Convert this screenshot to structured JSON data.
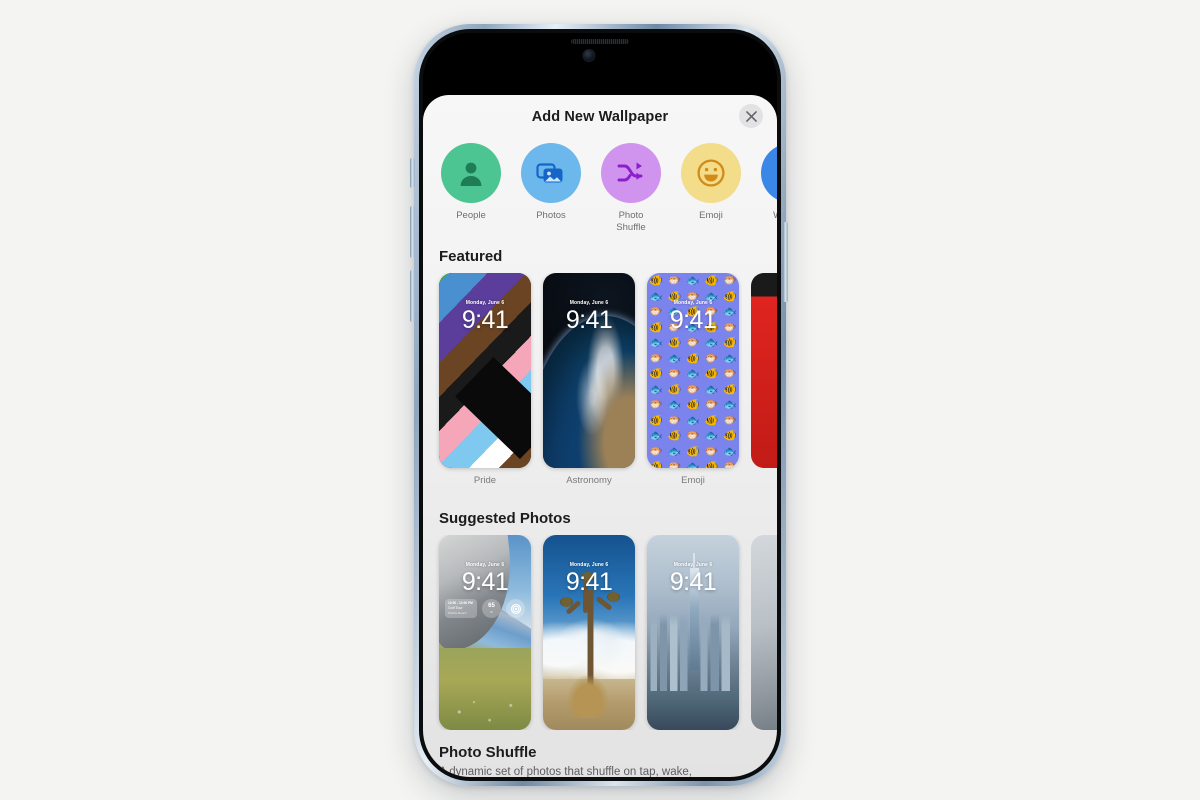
{
  "sheet": {
    "title": "Add New Wallpaper",
    "close_icon": "close-x-icon"
  },
  "categories": [
    {
      "id": "people",
      "label": "People",
      "icon": "person-icon",
      "color": "#4cc592"
    },
    {
      "id": "photos",
      "label": "Photos",
      "icon": "photo-stack-icon",
      "color": "#6cb8ec"
    },
    {
      "id": "photo-shuffle",
      "label": "Photo\nShuffle",
      "icon": "shuffle-icon",
      "color": "#d094ee"
    },
    {
      "id": "emoji",
      "label": "Emoji",
      "icon": "smiley-icon",
      "color": "#f3dc8a"
    },
    {
      "id": "weather",
      "label": "Weather",
      "icon": "sun-cloud-icon",
      "color": "#3b87e8"
    }
  ],
  "category_icon_colors": {
    "people": "#1f7d55",
    "photos": "#1565c9",
    "photo_shuffle": "#8b1fce",
    "emoji": "#d18b18",
    "weather": "#1d2ab0"
  },
  "featured": {
    "title": "Featured",
    "items": [
      {
        "name": "Pride",
        "date": "Monday, June 6",
        "time": "9:41"
      },
      {
        "name": "Astronomy",
        "date": "Monday, June 6",
        "time": "9:41"
      },
      {
        "name": "Emoji",
        "date": "Monday, June 6",
        "time": "9:41"
      }
    ],
    "emoji_glyphs": [
      "🐠",
      "🐡",
      "🐟",
      "🐠",
      "🐡",
      "🐟",
      "🐠",
      "🐡",
      "🐟",
      "🐠",
      "🐡",
      "🐟",
      "🐠",
      "🐡",
      "🐟",
      "🐠",
      "🐡",
      "🐟",
      "🐠",
      "🐡",
      "🐟",
      "🐠",
      "🐡",
      "🐟",
      "🐠",
      "🐡",
      "🐟",
      "🐠",
      "🐡",
      "🐟",
      "🐠",
      "🐡",
      "🐟",
      "🐠",
      "🐡",
      "🐟",
      "🐠",
      "🐡",
      "🐟",
      "🐠",
      "🐡",
      "🐟",
      "🐠",
      "🐡",
      "🐟",
      "🐠",
      "🐡",
      "🐟",
      "🐠",
      "🐡",
      "🐟",
      "🐠",
      "🐡",
      "🐟",
      "🐠",
      "🐡",
      "🐟",
      "🐠",
      "🐡",
      "🐟",
      "🐠",
      "🐡",
      "🐟",
      "🐠",
      "🐡"
    ]
  },
  "suggested": {
    "title": "Suggested Photos",
    "items": [
      {
        "id": "stadium",
        "date": "Monday, June 6",
        "time": "9:41"
      },
      {
        "id": "joshua",
        "date": "Monday, June 6",
        "time": "9:41"
      },
      {
        "id": "nyc",
        "date": "Monday, June 6",
        "time": "9:41"
      }
    ],
    "widgets": {
      "calendar": {
        "line1": "12:00 - 12:00 PM",
        "line2": "Golf Tour",
        "line3": "Pebble Beach"
      },
      "ring": {
        "value": "65",
        "unit": "%"
      },
      "icon": "activity-icon"
    }
  },
  "photo_shuffle": {
    "title": "Photo Shuffle",
    "description": "A dynamic set of photos that shuffle on tap, wake,"
  },
  "colors": {
    "page_background": "#f4f4f2",
    "sheet_background": "#f2f2f2",
    "title_text": "#1c1c1e",
    "secondary_text": "#6e6e73",
    "emoji_wallpaper": "#7b83ed",
    "partial_card_red": "#e0241f"
  }
}
